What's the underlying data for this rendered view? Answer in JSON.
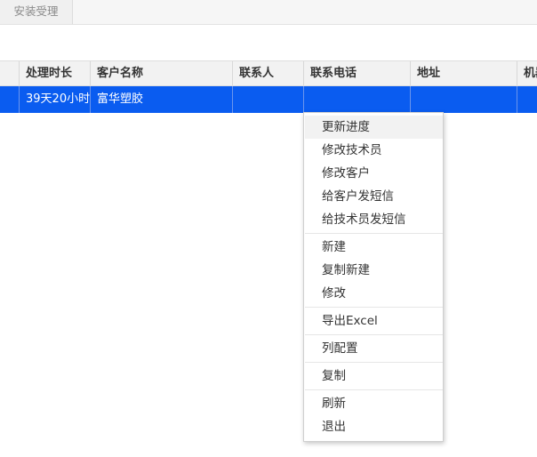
{
  "tabs": [
    {
      "label": "安装受理"
    }
  ],
  "grid": {
    "columns": [
      "处理时长",
      "客户名称",
      "联系人",
      "联系电话",
      "地址",
      "机器"
    ],
    "selected_row": [
      "39天20小时",
      "富华塑胶",
      "",
      "",
      "",
      ""
    ]
  },
  "context_menu": {
    "groups": [
      [
        "更新进度",
        "修改技术员",
        "修改客户",
        "给客户发短信",
        "给技术员发短信"
      ],
      [
        "新建",
        "复制新建",
        "修改"
      ],
      [
        "导出Excel"
      ],
      [
        "列配置"
      ],
      [
        "复制"
      ],
      [
        "刷新",
        "退出"
      ]
    ]
  },
  "colors": {
    "selection": "#0a5cf0",
    "header_bg": "#f2f2f2"
  }
}
